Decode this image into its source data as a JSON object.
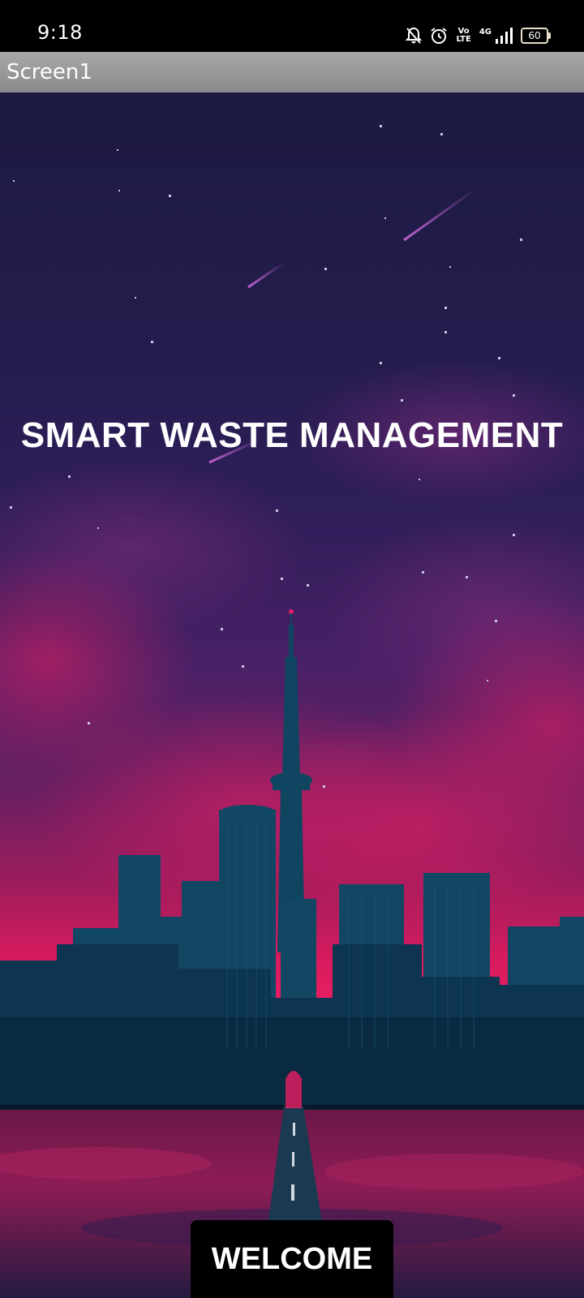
{
  "status_bar": {
    "time": "9:18",
    "volte_top": "Vo",
    "volte_bottom": "LTE",
    "network": "4G",
    "battery": "60",
    "icons": [
      "mute-bell-icon",
      "alarm-icon",
      "volte-icon",
      "signal-icon",
      "battery-icon"
    ]
  },
  "title_bar": {
    "title": "Screen1"
  },
  "main": {
    "headline": "SMART WASTE MANAGEMENT",
    "welcome_label": "WELCOME",
    "background": "night-city-skyline-illustration"
  },
  "colors": {
    "status_bar_bg": "#000000",
    "title_bar_bg": "#999999",
    "sky_top": "#1c1a42",
    "sky_pink": "#e91e63",
    "skyline": "#0f3a52",
    "button_bg": "#000000",
    "text": "#ffffff"
  }
}
